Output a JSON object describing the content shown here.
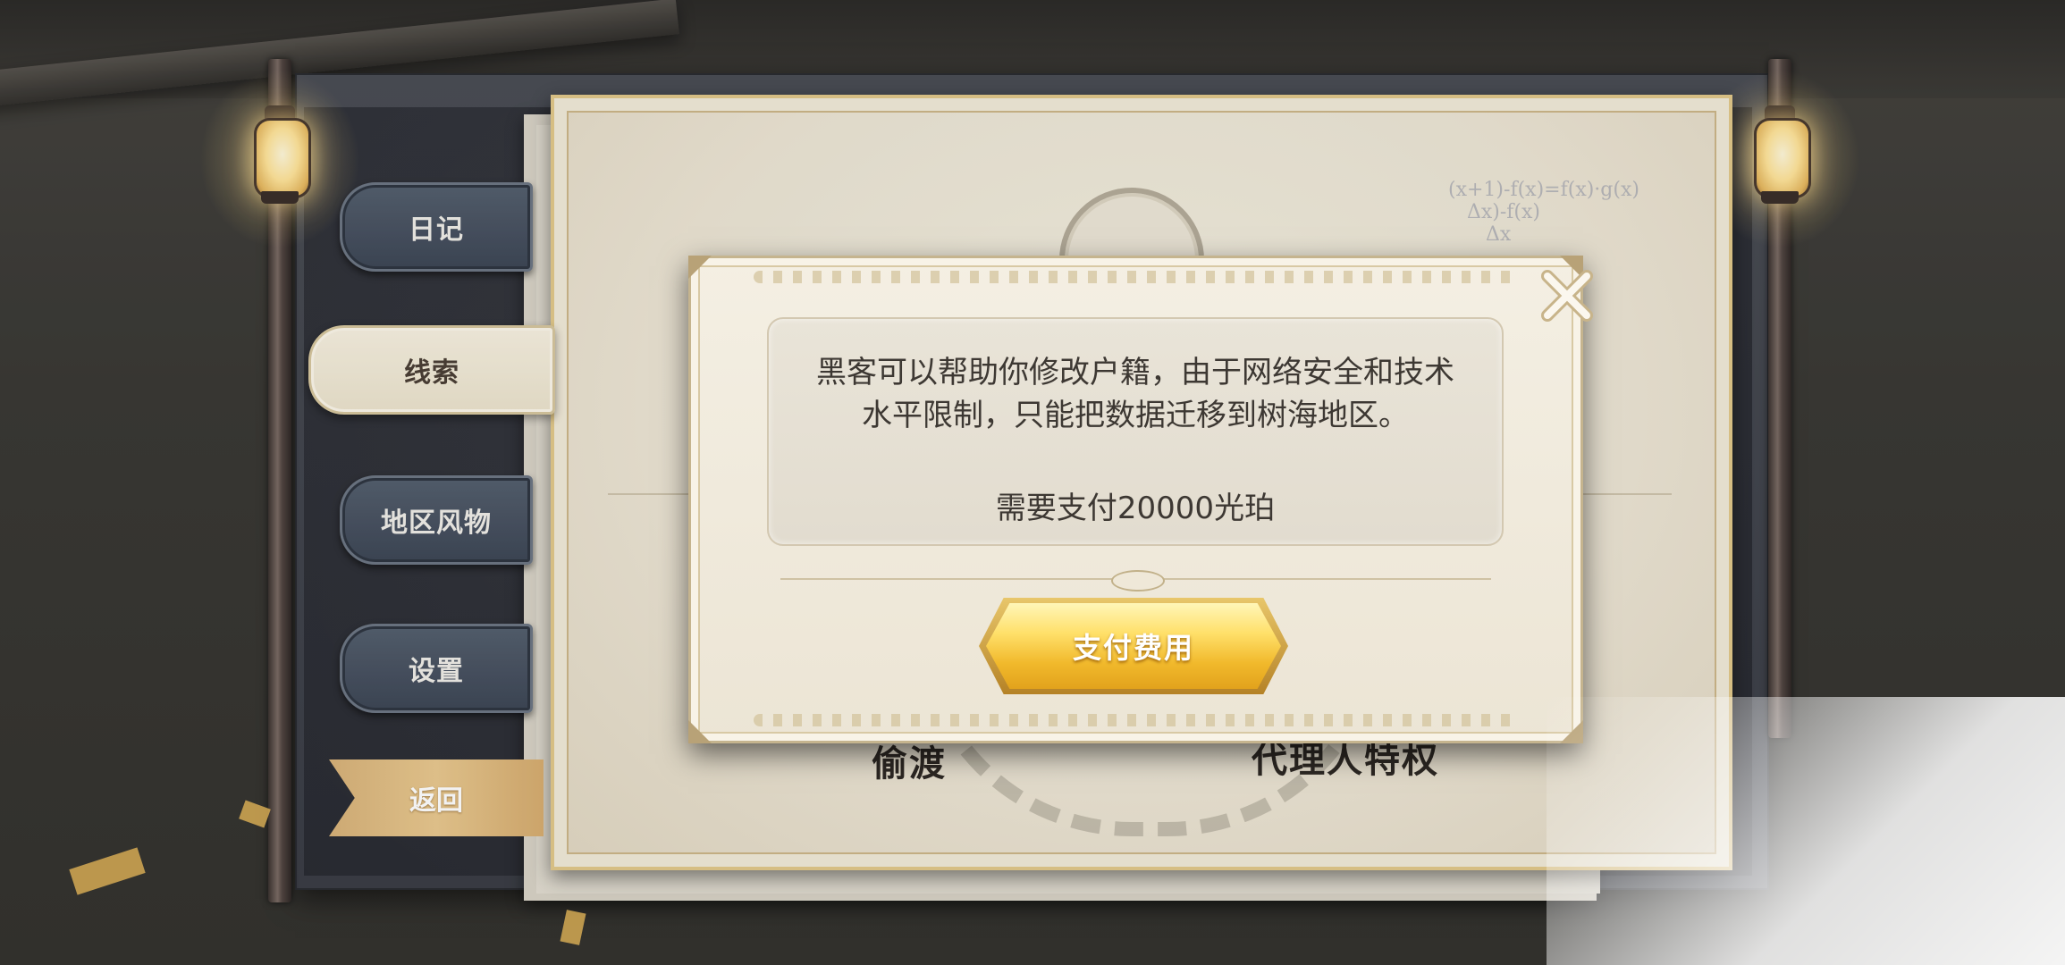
{
  "sidebar": {
    "tabs": [
      {
        "label": "日记"
      },
      {
        "label": "线索"
      },
      {
        "label": "地区风物"
      },
      {
        "label": "设置"
      }
    ],
    "active_tab": "线索",
    "back_label": "返回"
  },
  "document": {
    "labels": [
      "偷渡",
      "代理人特权"
    ]
  },
  "modal": {
    "message_line1": "黑客可以帮助你修改户籍，由于网络安全和技术",
    "message_line2": "水平限制，只能把数据迁移到树海地区。",
    "cost_text": "需要支付20000光珀",
    "pay_button_label": "支付费用",
    "close_icon": "close-icon"
  },
  "colors": {
    "tab_bg": "#4a5463",
    "tab_active_bg": "#f2ebd9",
    "back_button": "#e2c088",
    "pay_button": "#f7c93c",
    "parchment": "#efe9da"
  }
}
